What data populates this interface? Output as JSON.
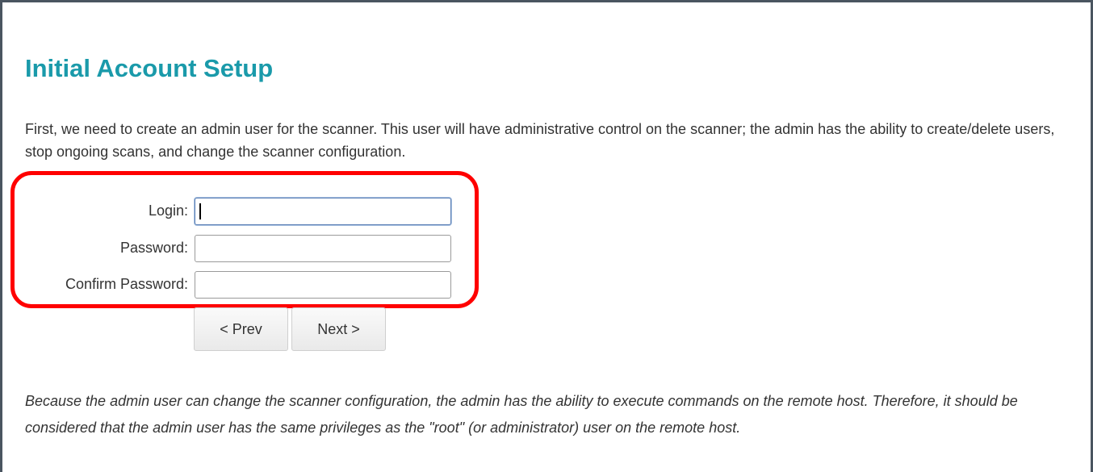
{
  "page": {
    "title": "Initial Account Setup",
    "intro": "First, we need to create an admin user for the scanner. This user will have administrative control on the scanner; the admin has the ability to create/delete users, stop ongoing scans, and change the scanner configuration.",
    "note": "Because the admin user can change the scanner configuration, the admin has the ability to execute commands on the remote host. Therefore, it should be considered that the admin user has the same privileges as the \"root\" (or administrator) user on the remote host."
  },
  "form": {
    "login_label": "Login:",
    "login_value": "",
    "password_label": "Password:",
    "password_value": "",
    "confirm_label": "Confirm Password:",
    "confirm_value": ""
  },
  "buttons": {
    "prev_label": "< Prev",
    "next_label": "Next >"
  },
  "colors": {
    "title": "#1a9aaa",
    "highlight": "#ff0000",
    "text": "#333333"
  }
}
